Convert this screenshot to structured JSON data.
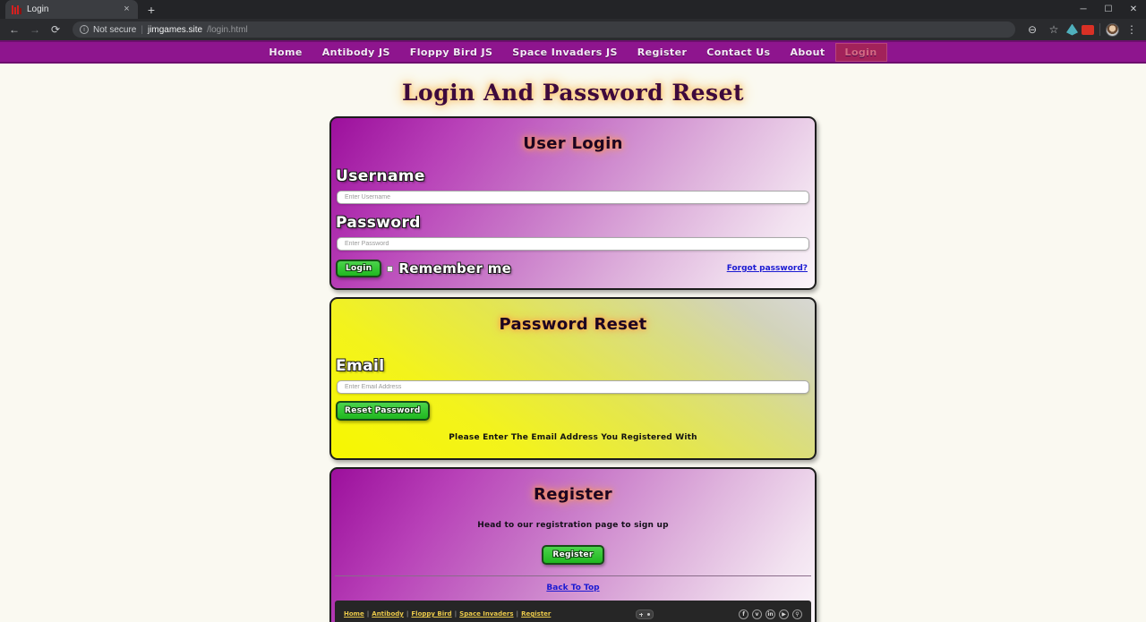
{
  "browser": {
    "tab": {
      "title": "Login",
      "favicon": "invader-favicon",
      "close": "×"
    },
    "newtab_label": "+",
    "window_controls": {
      "minimize": "─",
      "maximize": "☐",
      "close": "✕"
    },
    "toolbar": {
      "back": "←",
      "forward": "→",
      "reload": "⟳",
      "security_text": "Not secure",
      "separator": "|",
      "url_host": "jimgames.site",
      "url_path": "/login.html",
      "zoom_icon": "⊖",
      "bookmark_icon": "☆",
      "extension_a": "drop-extension-icon",
      "extension_b": "red-extension-icon",
      "profile": "avatar",
      "menu_icon": "⋮"
    }
  },
  "nav": {
    "items": [
      {
        "label": "Home",
        "active": false
      },
      {
        "label": "Antibody JS",
        "active": false
      },
      {
        "label": "Floppy Bird JS",
        "active": false
      },
      {
        "label": "Space Invaders JS",
        "active": false
      },
      {
        "label": "Register",
        "active": false
      },
      {
        "label": "Contact Us",
        "active": false
      },
      {
        "label": "About",
        "active": false
      },
      {
        "label": "Login",
        "active": true
      }
    ]
  },
  "page": {
    "title": "Login And Password Reset",
    "background_color": "#faf9f1",
    "accent_purple": "#8e158e",
    "accent_yellow": "#f7f700",
    "accent_green": "#1fb81f",
    "link_color": "#1a1ad2"
  },
  "login_card": {
    "title": "User Login",
    "username_label": "Username",
    "username_placeholder": "Enter Username",
    "username_value": "",
    "password_label": "Password",
    "password_placeholder": "Enter Password",
    "password_value": "",
    "login_button": "Login",
    "remember_label": "Remember me",
    "remember_checked": false,
    "forgot_link": "Forgot password?"
  },
  "reset_card": {
    "title": "Password Reset",
    "email_label": "Email",
    "email_placeholder": "Enter Email Address",
    "email_value": "",
    "reset_button": "Reset Password",
    "note": "Please Enter The Email Address You Registered With"
  },
  "register_card": {
    "title": "Register",
    "subtitle": "Head to our registration page to sign up",
    "register_button": "Register",
    "back_to_top": "Back To Top"
  },
  "footer": {
    "links": [
      "Home",
      "Antibody",
      "Floppy Bird",
      "Space Invaders",
      "Register"
    ],
    "separator": "|",
    "center_icon": "gamepad-icon",
    "socials": [
      {
        "name": "facebook-icon",
        "glyph": "f"
      },
      {
        "name": "twitter-icon",
        "glyph": "ᴠ"
      },
      {
        "name": "linkedin-icon",
        "glyph": "in"
      },
      {
        "name": "youtube-icon",
        "glyph": "▶"
      },
      {
        "name": "search-icon",
        "glyph": "⚲"
      }
    ]
  }
}
